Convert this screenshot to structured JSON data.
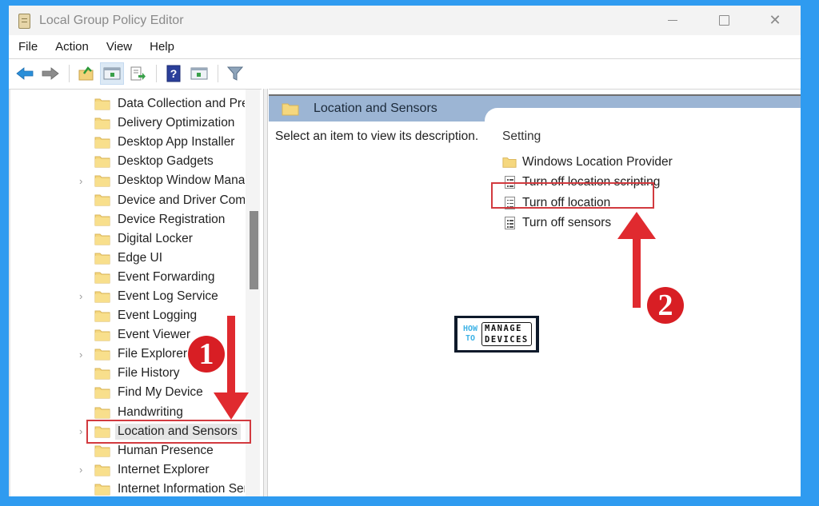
{
  "window": {
    "title": "Local Group Policy Editor",
    "controls": {
      "minimize": "minimize-icon",
      "maximize": "maximize-icon",
      "close": "close-icon",
      "close_glyph": "✕"
    }
  },
  "menu": [
    "File",
    "Action",
    "View",
    "Help"
  ],
  "toolbar": [
    {
      "name": "back-button",
      "icon": "back-arrow-icon"
    },
    {
      "name": "forward-button",
      "icon": "forward-arrow-icon"
    },
    {
      "name": "up-one-level-button",
      "icon": "folder-up-icon"
    },
    {
      "name": "show-hide-console-tree-button",
      "icon": "console-tree-icon",
      "active": true
    },
    {
      "name": "export-list-button",
      "icon": "export-list-icon"
    },
    {
      "name": "help-button",
      "icon": "help-icon",
      "glyph": "?"
    },
    {
      "name": "show-hide-action-pane-button",
      "icon": "action-pane-icon"
    },
    {
      "name": "filter-button",
      "icon": "filter-icon"
    }
  ],
  "tree": {
    "items": [
      {
        "label": "Data Collection and Preview Builds",
        "expandable": false
      },
      {
        "label": "Delivery Optimization",
        "expandable": false
      },
      {
        "label": "Desktop App Installer",
        "expandable": false
      },
      {
        "label": "Desktop Gadgets",
        "expandable": false
      },
      {
        "label": "Desktop Window Manager",
        "expandable": true
      },
      {
        "label": "Device and Driver Compatibility",
        "expandable": false
      },
      {
        "label": "Device Registration",
        "expandable": false
      },
      {
        "label": "Digital Locker",
        "expandable": false
      },
      {
        "label": "Edge UI",
        "expandable": false
      },
      {
        "label": "Event Forwarding",
        "expandable": false
      },
      {
        "label": "Event Log Service",
        "expandable": true
      },
      {
        "label": "Event Logging",
        "expandable": false
      },
      {
        "label": "Event Viewer",
        "expandable": false
      },
      {
        "label": "File Explorer",
        "expandable": true
      },
      {
        "label": "File History",
        "expandable": false
      },
      {
        "label": "Find My Device",
        "expandable": false
      },
      {
        "label": "Handwriting",
        "expandable": false
      },
      {
        "label": "Location and Sensors",
        "expandable": true,
        "selected": true
      },
      {
        "label": "Human Presence",
        "expandable": false
      },
      {
        "label": "Internet Explorer",
        "expandable": true
      },
      {
        "label": "Internet Information Services",
        "expandable": false
      }
    ],
    "chevron_glyph": "›"
  },
  "details": {
    "header_title": "Location and Sensors",
    "description": "Select an item to view its description.",
    "column_header": "Setting",
    "settings": [
      {
        "label": "Windows Location Provider",
        "type": "folder"
      },
      {
        "label": "Turn off location scripting",
        "type": "policy"
      },
      {
        "label": "Turn off location",
        "type": "policy",
        "highlighted": true
      },
      {
        "label": "Turn off sensors",
        "type": "policy"
      }
    ]
  },
  "annotations": {
    "step1": "1",
    "step2": "2",
    "accent_color": "#d81e24"
  },
  "watermark": {
    "line1_left": "HOW",
    "line2_left": "TO",
    "line1_right": "MANAGE",
    "line2_right": "DEVICES"
  }
}
